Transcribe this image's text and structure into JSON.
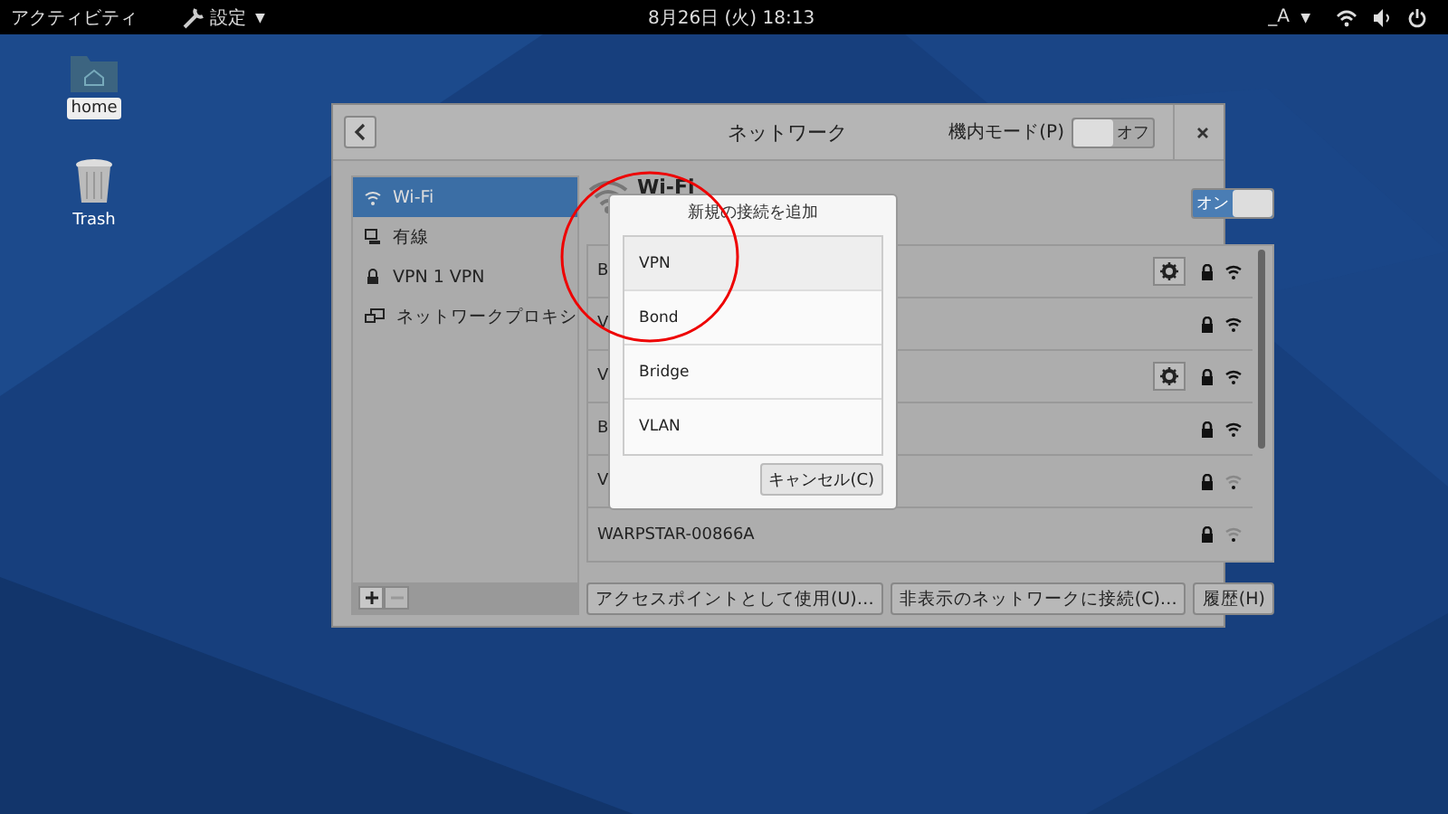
{
  "top_bar": {
    "activities": "アクティビティ",
    "app_menu": "設定",
    "app_menu_caret": "▼",
    "clock": "8月26日 (火) 18:13",
    "input_method": "_A",
    "input_method_caret": "▼"
  },
  "desktop_icons": [
    {
      "kind": "folder",
      "label": "home",
      "selected": true
    },
    {
      "kind": "trash",
      "label": "Trash",
      "selected": false
    }
  ],
  "window": {
    "title": "ネットワーク",
    "airplane_mode": {
      "label": "機内モード(P)",
      "on": false,
      "state_text": "オフ"
    },
    "sidebar": {
      "items": [
        {
          "kind": "wifi",
          "label": "Wi-Fi",
          "selected": true
        },
        {
          "kind": "wired",
          "label": "有線",
          "selected": false
        },
        {
          "kind": "vpn",
          "label": "VPN 1 VPN",
          "selected": false
        },
        {
          "kind": "proxy",
          "label": "ネットワークプロキシ",
          "selected": false
        }
      ]
    },
    "wifi": {
      "title": "Wi-Fi",
      "on": true,
      "state_text": "オン",
      "networks": [
        {
          "name": "B",
          "settings": true,
          "weak": false
        },
        {
          "name": "V",
          "settings": false,
          "weak": false
        },
        {
          "name": "V",
          "settings": true,
          "weak": false
        },
        {
          "name": "B",
          "settings": false,
          "weak": false
        },
        {
          "name": "V",
          "settings": false,
          "weak": true
        },
        {
          "name": "WARPSTAR-00866A",
          "settings": false,
          "weak": true
        }
      ]
    },
    "buttons": [
      "アクセスポイントとして使用(U)…",
      "非表示のネットワークに接続(C)…",
      "履歴(H)"
    ]
  },
  "dialog": {
    "title": "新規の接続を追加",
    "options": [
      {
        "label": "VPN",
        "selected": true
      },
      {
        "label": "Bond",
        "selected": false
      },
      {
        "label": "Bridge",
        "selected": false
      },
      {
        "label": "VLAN",
        "selected": false
      }
    ],
    "cancel": "キャンセル(C)"
  }
}
